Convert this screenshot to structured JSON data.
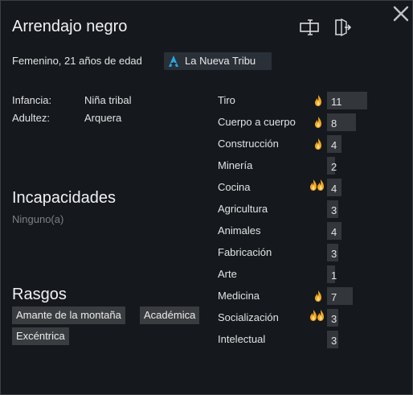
{
  "pawn": {
    "name": "Arrendajo negro",
    "description": "Femenino, 21 años de edad",
    "faction": "La Nueva Tribu"
  },
  "backstory": {
    "childhood_label": "Infancia:",
    "childhood_value": "Niña tribal",
    "adulthood_label": "Adultez:",
    "adulthood_value": "Arquera"
  },
  "incapacities": {
    "title": "Incapacidades",
    "value": "Ninguno(a)"
  },
  "traits": {
    "title": "Rasgos",
    "items": [
      "Amante de la montaña",
      "Académica",
      "Excéntrica"
    ]
  },
  "skills": [
    {
      "name": "Tiro",
      "level": "11",
      "passion": "minor"
    },
    {
      "name": "Cuerpo a cuerpo",
      "level": "8",
      "passion": "minor"
    },
    {
      "name": "Construcción",
      "level": "4",
      "passion": "minor"
    },
    {
      "name": "Minería",
      "level": "2",
      "passion": "none"
    },
    {
      "name": "Cocina",
      "level": "4",
      "passion": "major"
    },
    {
      "name": "Agricultura",
      "level": "3",
      "passion": "none"
    },
    {
      "name": "Animales",
      "level": "4",
      "passion": "none"
    },
    {
      "name": "Fabricación",
      "level": "3",
      "passion": "none"
    },
    {
      "name": "Arte",
      "level": "1",
      "passion": "none"
    },
    {
      "name": "Medicina",
      "level": "7",
      "passion": "minor"
    },
    {
      "name": "Socialización",
      "level": "3",
      "passion": "major"
    },
    {
      "name": "Intelectual",
      "level": "3",
      "passion": "none"
    }
  ],
  "icons": {
    "close": "close-icon",
    "rename": "rename-icon",
    "banish": "banish-icon",
    "faction": "faction-icon",
    "passion_minor": "flame-icon",
    "passion_major": "double-flame-icon"
  },
  "colors": {
    "background": "#15191e",
    "skill_bar": "#33373c",
    "trait_chip": "#3a3d40",
    "faction_chip": "#2a3038",
    "faction_icon": "#2aa8e0",
    "flame": "#f5a623",
    "muted_text": "#7d8084"
  }
}
